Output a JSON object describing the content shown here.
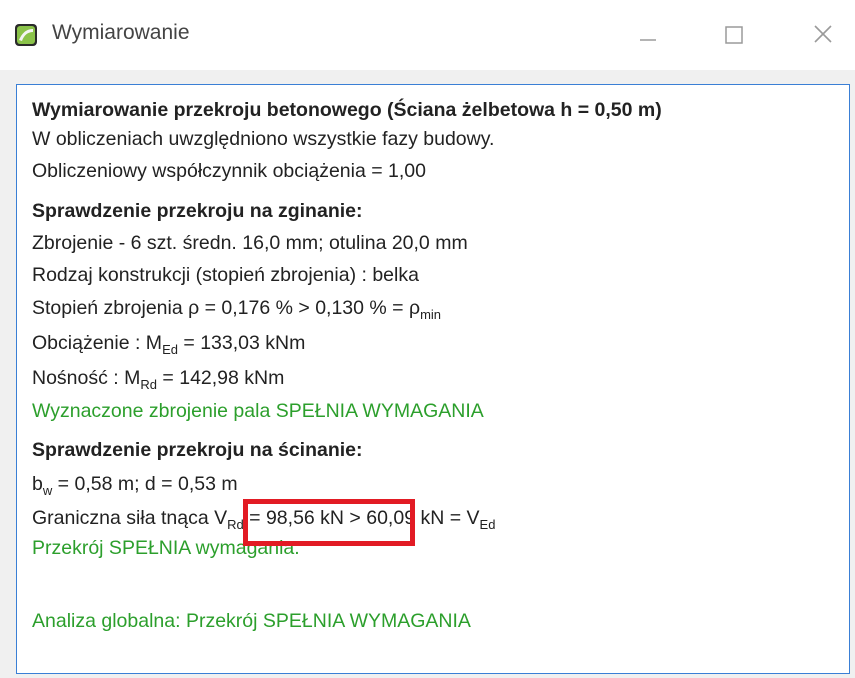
{
  "window": {
    "title": "Wymiarowanie",
    "accent_color": "#3a7fd5"
  },
  "report": {
    "heading": "Wymiarowanie przekroju betonowego (Ściana żelbetowa h = 0,50 m)",
    "phases_note": "W obliczeniach uwzględniono wszystkie fazy budowy.",
    "load_factor": "Obliczeniowy współczynnik obciążenia = 1,00",
    "bending": {
      "title": "Sprawdzenie przekroju na zginanie:",
      "reinforcement": "Zbrojenie - 6 szt. średn. 16,0 mm; otulina 20,0 mm",
      "construction_type": "Rodzaj konstrukcji (stopień zbrojenia) : belka",
      "ratio_prefix": "Stopień zbrojenia ρ = 0,176 % > 0,130 % = ρ",
      "ratio_sub": "min",
      "load_prefix": "Obciążenie : M",
      "load_sub": "Ed",
      "load_value": " = 133,03 kNm",
      "capacity_prefix": "Nośność : M",
      "capacity_sub": "Rd",
      "capacity_value": " = 142,98 kNm",
      "result": "Wyznaczone zbrojenie pala SPEŁNIA WYMAGANIA"
    },
    "shear": {
      "title": "Sprawdzenie przekroju na ścinanie:",
      "geom_b": "b",
      "geom_b_sub": "w",
      "geom_rest": " = 0,58 m; d = 0,53 m",
      "force_label": "Graniczna siła tnąca ",
      "vrd_symbol": "V",
      "vrd_sub": "Rd",
      "vrd_value": " = 98,56 kN",
      "ved_compare": " > 60,09 kN = V",
      "ved_sub": "Ed",
      "result": "Przekrój SPEŁNIA wymagania."
    },
    "global_result": "Analiza globalna: Przekrój SPEŁNIA WYMAGANIA"
  },
  "colors": {
    "pass_text": "#2c9f2c",
    "highlight_box": "#e21b24"
  }
}
